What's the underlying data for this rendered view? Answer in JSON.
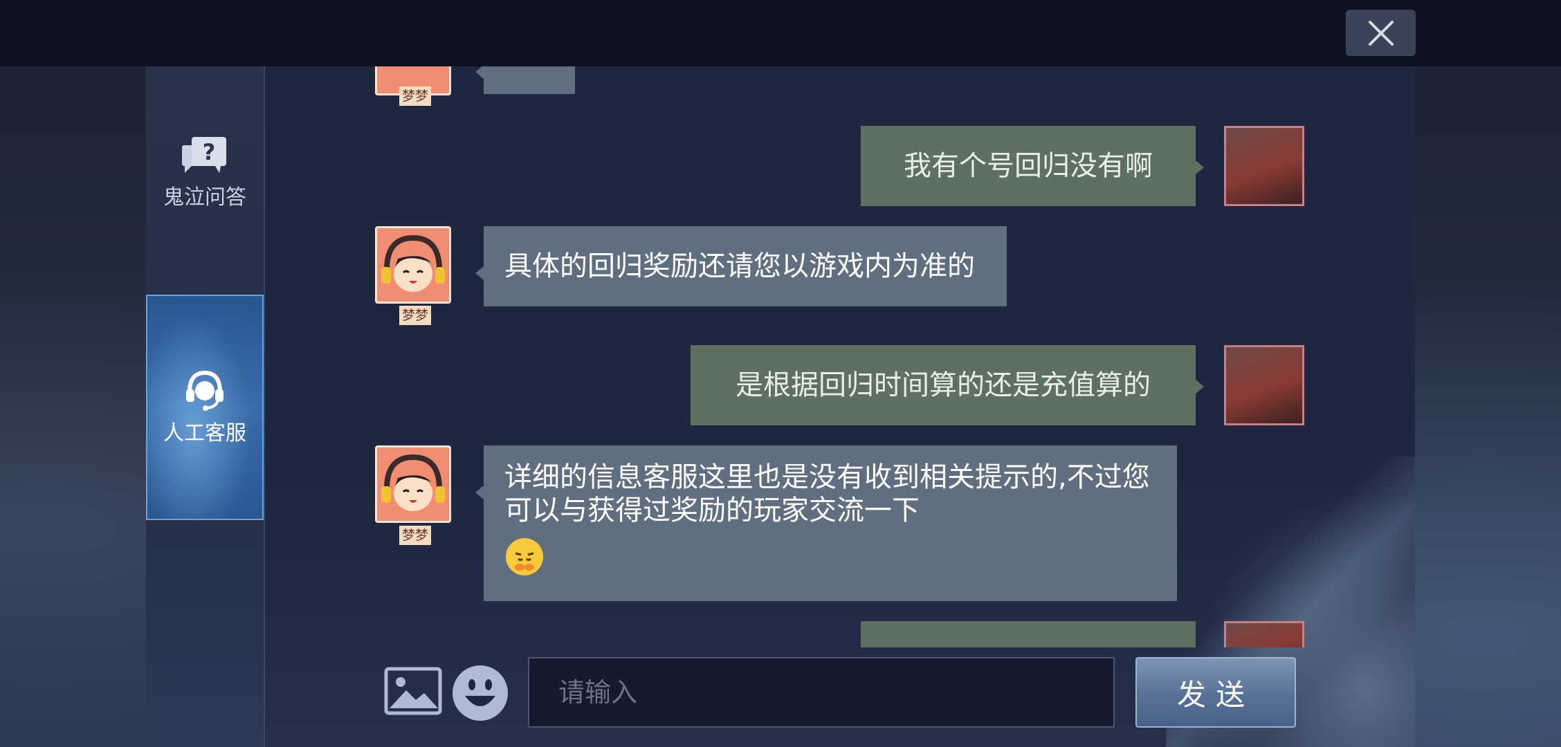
{
  "sidebar": {
    "items": [
      {
        "label": "鬼泣问答",
        "icon": "question-bubble-icon"
      },
      {
        "label": "人工客服",
        "icon": "headset-icon",
        "selected": true
      }
    ]
  },
  "chat": {
    "agent_name": "梦梦",
    "messages": [
      {
        "from": "user",
        "text": "我有个号回归没有啊"
      },
      {
        "from": "agent",
        "text": "具体的回归奖励还请您以游戏内为准的"
      },
      {
        "from": "user",
        "text": "是根据回归时间算的还是充值算的"
      },
      {
        "from": "agent",
        "lines": [
          "详细的信息客服这里也是没有收到相关提示的,不过您",
          "可以与获得过奖励的玩家交流一下"
        ],
        "emoji": "pouting-face-emoji"
      }
    ]
  },
  "composer": {
    "placeholder": "请输入",
    "send_label": "发送",
    "image_icon": "image-icon",
    "emoji_icon": "emoji-icon"
  },
  "window": {
    "close_icon": "close-icon"
  }
}
